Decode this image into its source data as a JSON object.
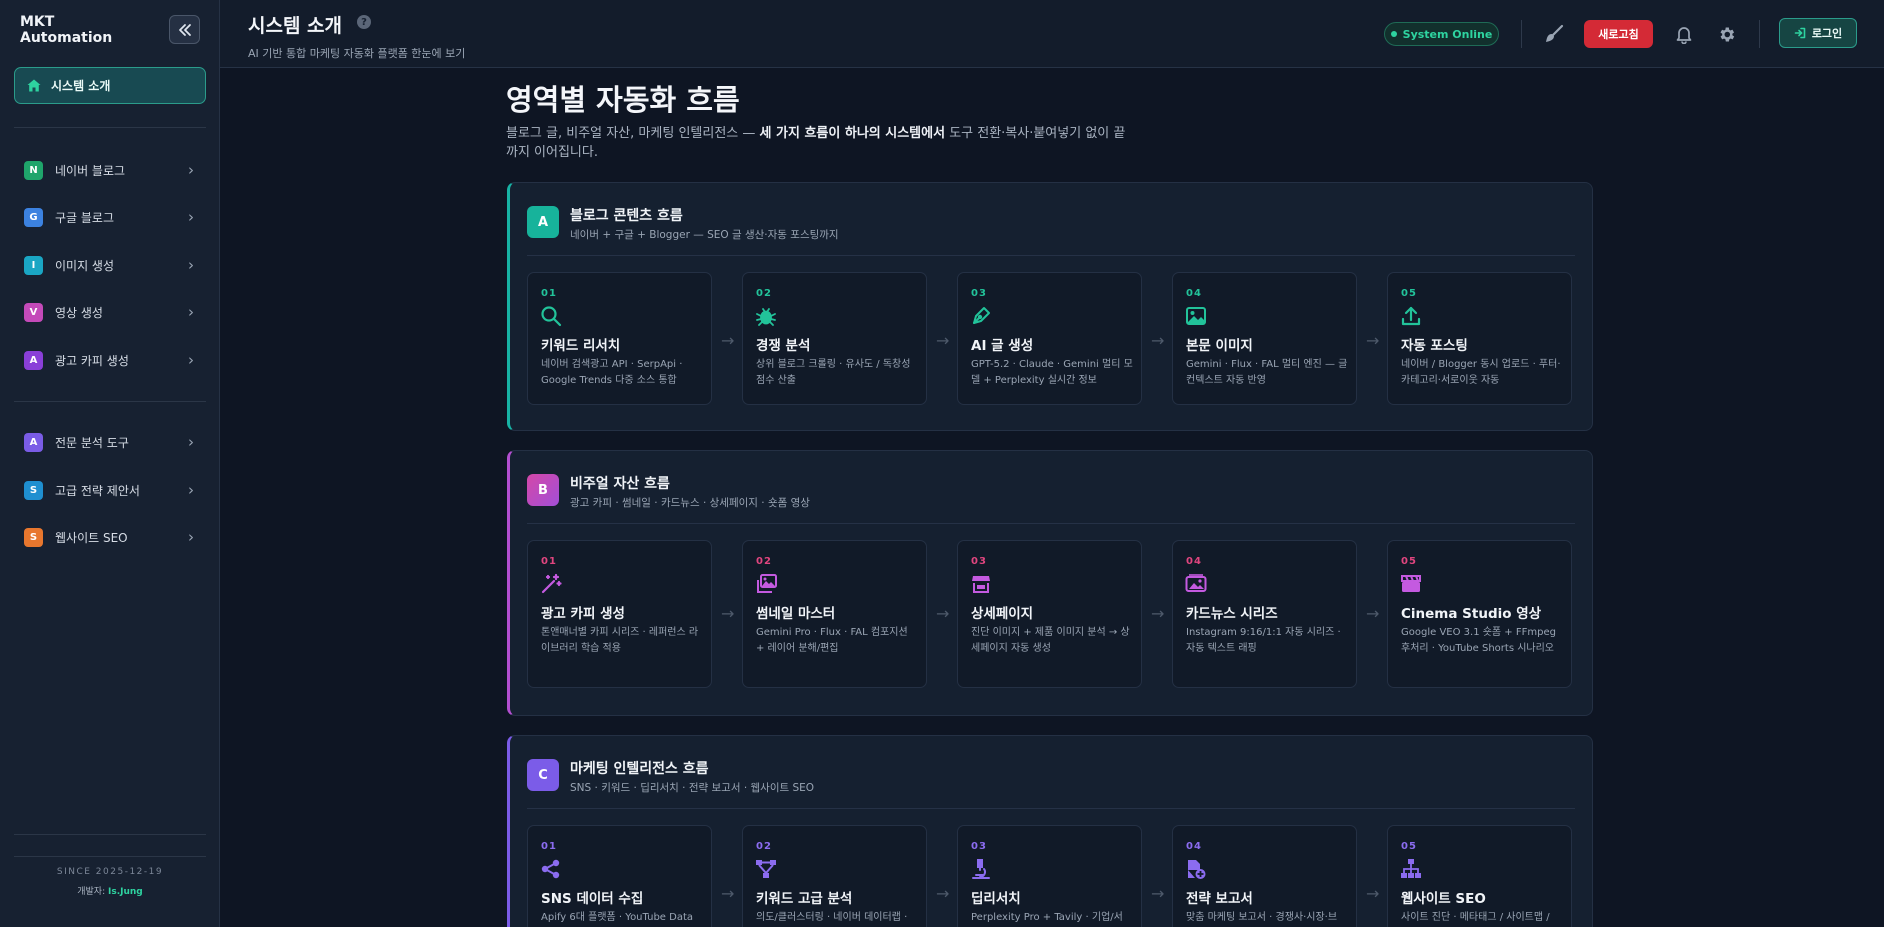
{
  "app": {
    "brand_line1": "MKT",
    "brand_line2": "Automation"
  },
  "sidebar": {
    "home_label": "시스템 소개",
    "group1": [
      {
        "badge": "N",
        "label": "네이버 블로그",
        "color": "#1fa56b"
      },
      {
        "badge": "G",
        "label": "구글 블로그",
        "color": "#3c82e0"
      },
      {
        "badge": "I",
        "label": "이미지 생성",
        "color": "#1aa6c4"
      },
      {
        "badge": "V",
        "label": "영상 생성",
        "color": "#c44ab9"
      },
      {
        "badge": "A",
        "label": "광고 카피 생성",
        "color": "#8a3fd8"
      }
    ],
    "group2": [
      {
        "badge": "A",
        "label": "전문 분석 도구",
        "color": "#7a5ce6"
      },
      {
        "badge": "S",
        "label": "고급 전략 제안서",
        "color": "#1f8fd0"
      },
      {
        "badge": "S",
        "label": "웹사이트 SEO",
        "color": "#e8772e"
      }
    ],
    "since": "SINCE 2025-12-19",
    "dev_prefix": "개발자:",
    "dev_name": "Is.Jung"
  },
  "header": {
    "title": "시스템 소개",
    "subtitle": "AI 기반 통합 마케팅 자동화 플랫폼 한눈에 보기",
    "status": "System Online",
    "refresh_label": "새로고침",
    "login_label": "로그인"
  },
  "main": {
    "title": "영역별 자동화 흐름",
    "desc_plain1": "블로그 글, 비주얼 자산, 마케팅 인텔리전스 — ",
    "desc_bold": "세 가지 흐름이 하나의 시스템에서",
    "desc_plain2": " 도구 전환·복사·붙여넣기 없이 끝까지 이어집니다."
  },
  "flows": [
    {
      "badge": "A",
      "badge_color": "#17b39b",
      "accent": "#17b3a5",
      "num_color": "#22c39a",
      "title": "블로그 콘텐츠 흐름",
      "subtitle": "네이버 + 구글 + Blogger — SEO 글 생산·자동 포스팅까지",
      "steps": [
        {
          "num": "01",
          "icon": "search-icon",
          "title": "키워드 리서치",
          "desc": "네이버 검색광고 API · SerpApi · Google Trends 다중 소스 통합"
        },
        {
          "num": "02",
          "icon": "bug-icon",
          "title": "경쟁 분석",
          "desc": "상위 블로그 크롤링 · 유사도 / 독창성 점수 산출"
        },
        {
          "num": "03",
          "icon": "pen-icon",
          "title": "AI 글 생성",
          "desc": "GPT-5.2 · Claude · Gemini 멀티 모델 + Perplexity 실시간 정보"
        },
        {
          "num": "04",
          "icon": "image-icon",
          "title": "본문 이미지",
          "desc": "Gemini · Flux · FAL 멀티 엔진 — 글 컨텍스트 자동 반영"
        },
        {
          "num": "05",
          "icon": "upload-icon",
          "title": "자동 포스팅",
          "desc": "네이버 / Blogger 동시 업로드 · 푸터·카테고리·서로이웃 자동"
        }
      ]
    },
    {
      "badge": "B",
      "badge_color": "#c94ab5",
      "accent": "#b34fd1",
      "num_color": "#e0457f",
      "title": "비주얼 자산 흐름",
      "subtitle": "광고 카피 · 썸네일 · 카드뉴스 · 상세페이지 · 숏폼 영상",
      "steps": [
        {
          "num": "01",
          "icon": "magic-wand-icon",
          "title": "광고 카피 생성",
          "desc": "톤앤매너별 카피 시리즈 · 레퍼런스 라이브러리 학습 적용"
        },
        {
          "num": "02",
          "icon": "images-icon",
          "title": "썸네일 마스터",
          "desc": "Gemini Pro · Flux · FAL 컴포지션 + 레이어 분해/편집"
        },
        {
          "num": "03",
          "icon": "store-icon",
          "title": "상세페이지",
          "desc": "진단 이미지 + 제품 이미지 분석 → 상세페이지 자동 생성"
        },
        {
          "num": "04",
          "icon": "photo-album-icon",
          "title": "카드뉴스 시리즈",
          "desc": "Instagram 9:16/1:1 자동 시리즈 · 자동 텍스트 래핑"
        },
        {
          "num": "05",
          "icon": "clapperboard-icon",
          "title": "Cinema Studio 영상",
          "desc": "Google VEO 3.1 숏폼 + FFmpeg 후처리 · YouTube Shorts 시나리오"
        }
      ]
    },
    {
      "badge": "C",
      "badge_color": "#7b5ce8",
      "accent": "#7b5ce8",
      "num_color": "#8b6cf0",
      "title": "마케팅 인텔리전스 흐름",
      "subtitle": "SNS · 키워드 · 딥리서치 · 전략 보고서 · 웹사이트 SEO",
      "steps": [
        {
          "num": "01",
          "icon": "share-icon",
          "title": "SNS 데이터 수집",
          "desc": "Apify 6대 플랫폼 · YouTube Data"
        },
        {
          "num": "02",
          "icon": "diagram-icon",
          "title": "키워드 고급 분석",
          "desc": "의도/클러스터링 · 네이버 데이터랩 ·"
        },
        {
          "num": "03",
          "icon": "microscope-icon",
          "title": "딥리서치",
          "desc": "Perplexity Pro + Tavily · 기업/서"
        },
        {
          "num": "04",
          "icon": "file-plus-icon",
          "title": "전략 보고서",
          "desc": "맞춤 마케팅 보고서 · 경쟁사·시장·브"
        },
        {
          "num": "05",
          "icon": "sitemap-icon",
          "title": "웹사이트 SEO",
          "desc": "사이트 진단 · 메타태그 / 사이트맵 /"
        }
      ]
    }
  ]
}
